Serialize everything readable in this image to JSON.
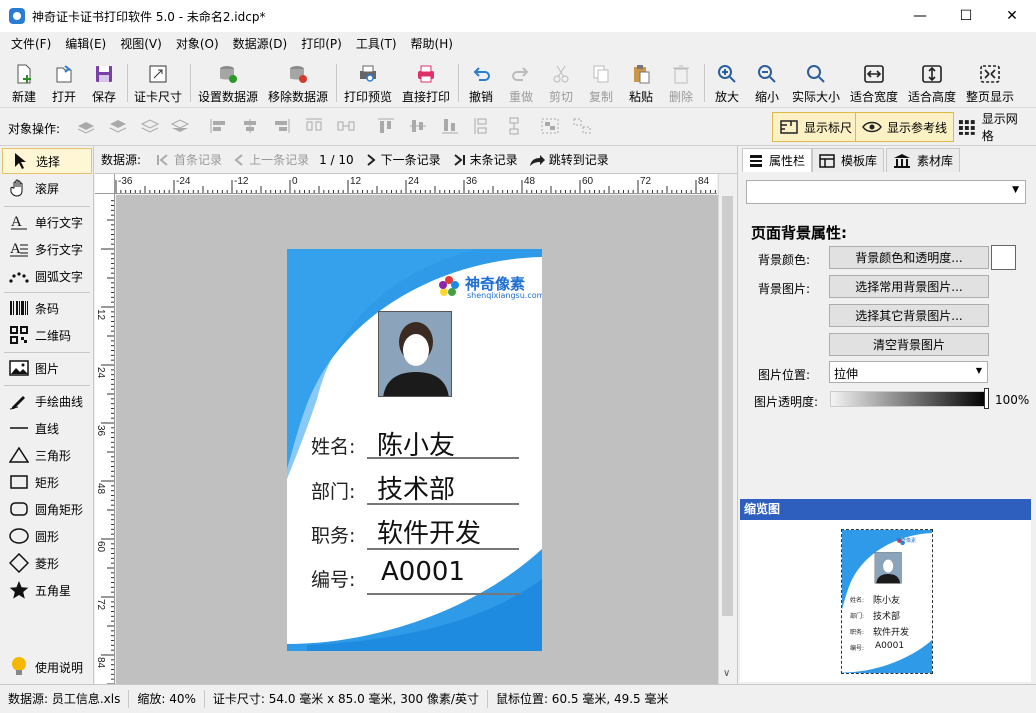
{
  "window": {
    "title": "神奇证卡证书打印软件 5.0 - 未命名2.idcp*",
    "minimize": "—",
    "maximize": "☐",
    "close": "✕"
  },
  "menu": [
    "文件(F)",
    "编辑(E)",
    "视图(V)",
    "对象(O)",
    "数据源(D)",
    "打印(P)",
    "工具(T)",
    "帮助(H)"
  ],
  "toolbar": {
    "new": "新建",
    "open": "打开",
    "save": "保存",
    "card_size": "证卡尺寸",
    "set_datasource": "设置数据源",
    "remove_datasource": "移除数据源",
    "print_preview": "打印预览",
    "direct_print": "直接打印",
    "undo": "撤销",
    "redo": "重做",
    "cut": "剪切",
    "copy": "复制",
    "paste": "粘贴",
    "delete": "删除",
    "zoom_in": "放大",
    "zoom_out": "缩小",
    "actual_size": "实际大小",
    "fit_width": "适合宽度",
    "fit_height": "适合高度",
    "fit_page": "整页显示"
  },
  "objbar": {
    "label": "对象操作:",
    "show_ruler": "显示标尺",
    "show_guides": "显示参考线",
    "show_grid": "显示网格"
  },
  "tools": {
    "select": "选择",
    "pan": "滚屏",
    "single_text": "单行文字",
    "multi_text": "多行文字",
    "arc_text": "圆弧文字",
    "barcode": "条码",
    "qrcode": "二维码",
    "image": "图片",
    "freehand": "手绘曲线",
    "line": "直线",
    "triangle": "三角形",
    "rect": "矩形",
    "round_rect": "圆角矩形",
    "ellipse": "圆形",
    "diamond": "菱形",
    "star": "五角星",
    "help": "使用说明"
  },
  "nav": {
    "label": "数据源:",
    "first": "首条记录",
    "prev": "上一条记录",
    "counter": "1 / 10",
    "next": "下一条记录",
    "last": "末条记录",
    "jump": "跳转到记录"
  },
  "ruler": {
    "top_ticks": [
      "-36",
      "-24",
      "-12",
      "0",
      "12",
      "24",
      "36",
      "48",
      "60",
      "72",
      "84"
    ],
    "left_ticks": [
      "12",
      "24",
      "36",
      "48",
      "60",
      "72",
      "84"
    ]
  },
  "card": {
    "brand": "神奇像素",
    "brand_url": "shenqixiangsu.com",
    "rows": [
      {
        "label": "姓名:",
        "value": "陈小友"
      },
      {
        "label": "部门:",
        "value": "技术部"
      },
      {
        "label": "职务:",
        "value": "软件开发"
      },
      {
        "label": "编号:",
        "value": "A0001"
      }
    ],
    "accent": "#2f9be8"
  },
  "right": {
    "tabs": [
      "属性栏",
      "模板库",
      "素材库"
    ],
    "section_title": "页面背景属性:",
    "bg_color_label": "背景颜色:",
    "bg_color_btn": "背景颜色和透明度...",
    "bg_image_label": "背景图片:",
    "bg_common_btn": "选择常用背景图片...",
    "bg_other_btn": "选择其它背景图片...",
    "bg_clear_btn": "清空背景图片",
    "img_pos_label": "图片位置:",
    "img_pos_value": "拉伸",
    "img_opacity_label": "图片透明度:",
    "img_opacity_value": "100%",
    "thumb_title": "缩览图"
  },
  "status": {
    "datasource": "数据源: 员工信息.xls",
    "zoom": "缩放: 40%",
    "card_size": "证卡尺寸: 54.0 毫米 x 85.0 毫米, 300 像素/英寸",
    "mouse": "鼠标位置: 60.5 毫米, 49.5 毫米"
  }
}
